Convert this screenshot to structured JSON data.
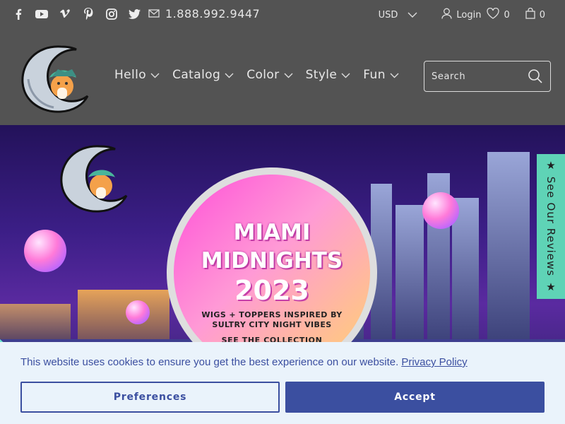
{
  "topbar": {
    "social": [
      {
        "icon": "facebook-icon",
        "glyph": "f"
      },
      {
        "icon": "youtube-icon",
        "glyph": "▶"
      },
      {
        "icon": "vimeo-icon",
        "glyph": "v"
      },
      {
        "icon": "pinterest-icon",
        "glyph": "P"
      },
      {
        "icon": "instagram-icon",
        "glyph": "◎"
      },
      {
        "icon": "twitter-icon",
        "glyph": "🐦"
      }
    ],
    "phone": "1.888.992.9447",
    "currency": "USD",
    "login_label": "Login",
    "wishlist_count": "0",
    "cart_count": "0"
  },
  "nav": {
    "items": [
      "Hello",
      "Catalog",
      "Color",
      "Style",
      "Fun"
    ]
  },
  "search": {
    "placeholder": "Search"
  },
  "hero": {
    "title": "MIAMI MIDNIGHTS",
    "year": "2023",
    "subtitle": "WIGS + TOPPERS INSPIRED BY SULTRY CITY NIGHT VIBES",
    "cta": "SEE THE COLLECTION"
  },
  "reviews_tab": {
    "label": "★ See Our Reviews ★"
  },
  "cookie": {
    "text": "This website uses cookies to ensure you get the best experience on our website.",
    "link": "Privacy Policy",
    "preferences": "Preferences",
    "accept": "Accept"
  },
  "colors": {
    "header_bg": "#535353",
    "accent_blue": "#3b4fa0",
    "teal": "#5fd3b6",
    "banner_bg": "#eaf3fb"
  }
}
